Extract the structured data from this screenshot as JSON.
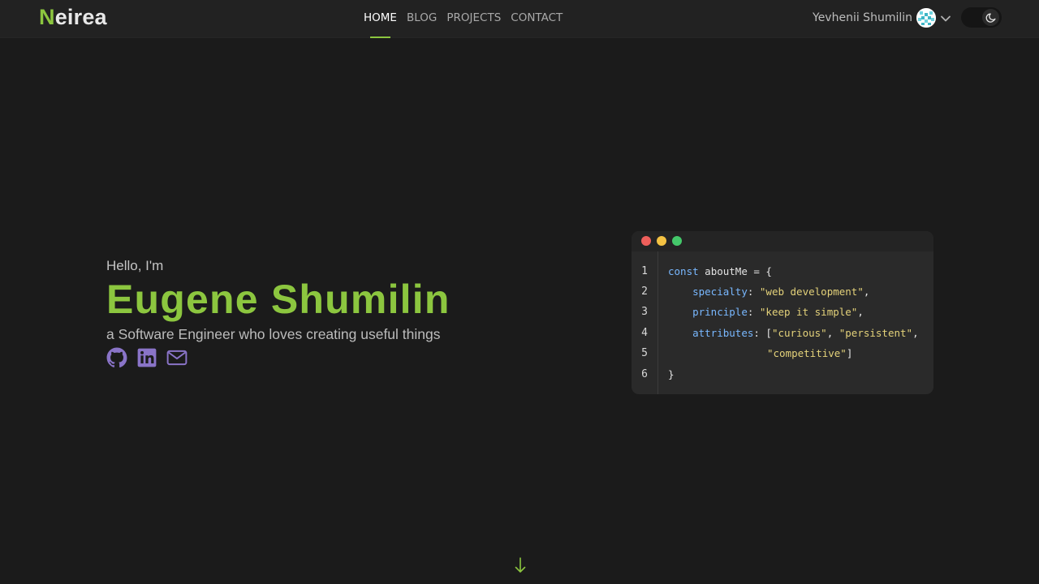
{
  "header": {
    "logo": {
      "first_letter": "N",
      "rest": "eirea"
    },
    "nav": [
      {
        "label": "HOME",
        "active": true
      },
      {
        "label": "BLOG",
        "active": false
      },
      {
        "label": "PROJECTS",
        "active": false
      },
      {
        "label": "CONTACT",
        "active": false
      }
    ],
    "user_name": "Yevhenii Shumilin",
    "avatar_icon": "pixel-avatar-icon",
    "theme_toggle": {
      "mode": "dark",
      "icon": "moon-icon"
    }
  },
  "hero": {
    "greeting": "Hello, I'm",
    "name": "Eugene Shumilin",
    "tagline": "a Software Engineer who loves creating useful things",
    "socials": [
      {
        "icon": "github-icon"
      },
      {
        "icon": "linkedin-icon"
      },
      {
        "icon": "mail-icon"
      }
    ]
  },
  "code_card": {
    "line_numbers": [
      "1",
      "2",
      "3",
      "4",
      "5",
      "6"
    ],
    "lines": {
      "l1": {
        "keyword": "const",
        "ident": "aboutMe",
        "rest": " = {"
      },
      "l2": {
        "key": "specialty",
        "sep": ": ",
        "value": "\"web development\"",
        "end": ","
      },
      "l3": {
        "key": "principle",
        "sep": ": ",
        "value": "\"keep it simple\"",
        "end": ","
      },
      "l4": {
        "key": "attributes",
        "sep": ": [",
        "value1": "\"curious\"",
        "comma": ", ",
        "value2": "\"persistent\"",
        "end": ","
      },
      "l5": {
        "value": "\"competitive\"",
        "end": "]"
      },
      "l6": {
        "text": "}"
      }
    }
  },
  "scroll_icon": "arrow-down-icon",
  "colors": {
    "accent": "#8cc63f",
    "background": "#1b1b1b",
    "header_bg": "#222222",
    "social_icons": "#8a74c8",
    "code_key": "#79b8ff",
    "code_string": "#e4d27a",
    "window_dot_red": "#ee5f5b",
    "window_dot_yellow": "#f4c243",
    "window_dot_green": "#44c86a"
  }
}
